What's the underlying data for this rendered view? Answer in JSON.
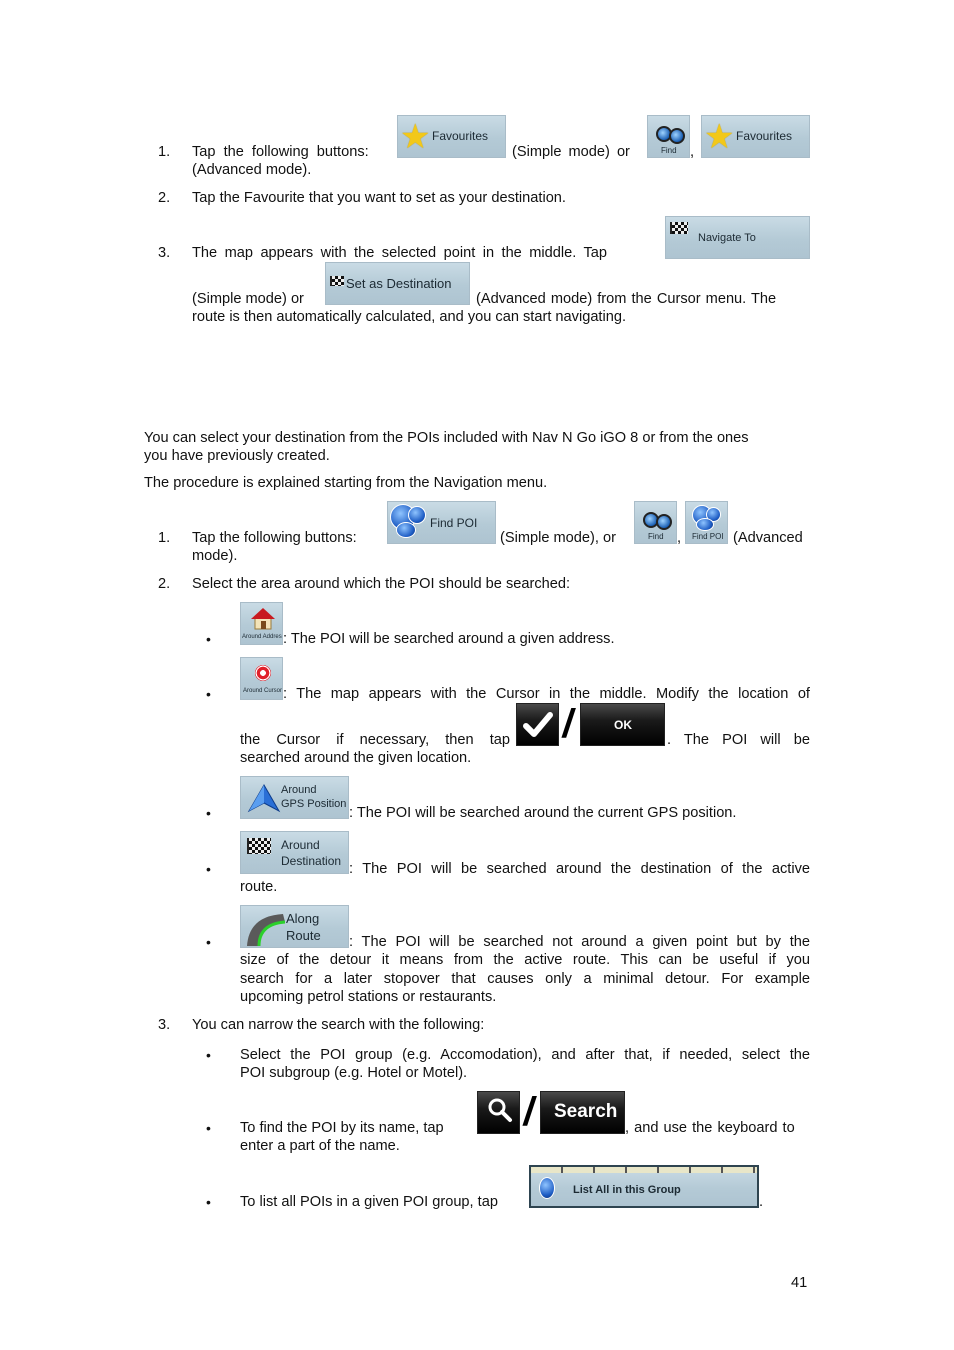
{
  "page_number": "41",
  "favourites_section": {
    "steps": [
      {
        "number": "1.",
        "text_before": "Tap the following buttons:",
        "text_middle": "(Simple mode) or",
        "comma": ",",
        "text_after": "(Advanced mode).",
        "buttons": {
          "simple": "Favourites",
          "advanced_find": "Find",
          "advanced_fav": "Favourites"
        }
      },
      {
        "number": "2.",
        "text": "Tap the Favourite that you want to set as your destination."
      },
      {
        "number": "3.",
        "text_before": "The map appears with the selected point in the middle. Tap",
        "text_simple": "(Simple mode) or",
        "text_after_line": "(Advanced mode) from the Cursor menu. The",
        "text_last": "route is then automatically calculated, and you can start navigating.",
        "buttons": {
          "simple": "Navigate To",
          "advanced": "Set as Destination"
        }
      }
    ]
  },
  "poi_section": {
    "intro_line1": "You can select your destination from the POIs included with Nav N Go iGO 8 or from the ones",
    "intro_line2": "you have previously created.",
    "procedure": "The procedure is explained starting from the Navigation menu.",
    "steps": [
      {
        "number": "1.",
        "text_before": "Tap the following buttons:",
        "text_middle": "(Simple mode), or",
        "comma": ",",
        "text_after": "(Advanced",
        "text_after2": "mode).",
        "buttons": {
          "simple": "Find POI",
          "advanced_find": "Find",
          "advanced_findpoi": "Find POI"
        }
      },
      {
        "number": "2.",
        "text": "Select the area around which the POI should be searched:",
        "options": [
          {
            "button": "Around Address",
            "text": ": The POI will be searched around a given address."
          },
          {
            "button": "Around Cursor",
            "text_line1": ": The map appears with the Cursor in the middle. Modify the location of",
            "text_line2_before": "the Cursor if necessary, then tap",
            "text_line2_after": ". The POI will be",
            "text_line3": "searched around the given location.",
            "confirm_button": "OK",
            "separator": "/"
          },
          {
            "button_line1": "Around",
            "button_line2": "GPS Position",
            "text": ": The POI will be searched around the current GPS position."
          },
          {
            "button_line1": "Around",
            "button_line2": "Destination",
            "text_line1": ": The POI will be searched around the destination of the active",
            "text_line2": "route."
          },
          {
            "button_line1": "Along",
            "button_line2": "Route",
            "text_line1": ": The POI will be searched not around a given point but by the",
            "text_line2": "size of the detour it means from the active route. This can be useful if you",
            "text_line3": "search for a later stopover that causes only a minimal detour. For example",
            "text_line4": "upcoming petrol stations or restaurants."
          }
        ]
      },
      {
        "number": "3.",
        "text": "You can narrow the search with the following:",
        "options": [
          {
            "text_line1": "Select the POI group (e.g. Accomodation), and after that, if needed, select the",
            "text_line2": "POI subgroup (e.g. Hotel or Motel)."
          },
          {
            "text_before": "To find the POI by its name, tap",
            "text_after": ", and use the keyboard to",
            "text_line2": "enter a part of the name.",
            "search_button": "Search",
            "separator": "/"
          },
          {
            "text_before": "To list all POIs in a given POI group, tap",
            "text_after": ".",
            "button": "List All in this Group"
          }
        ]
      }
    ]
  }
}
